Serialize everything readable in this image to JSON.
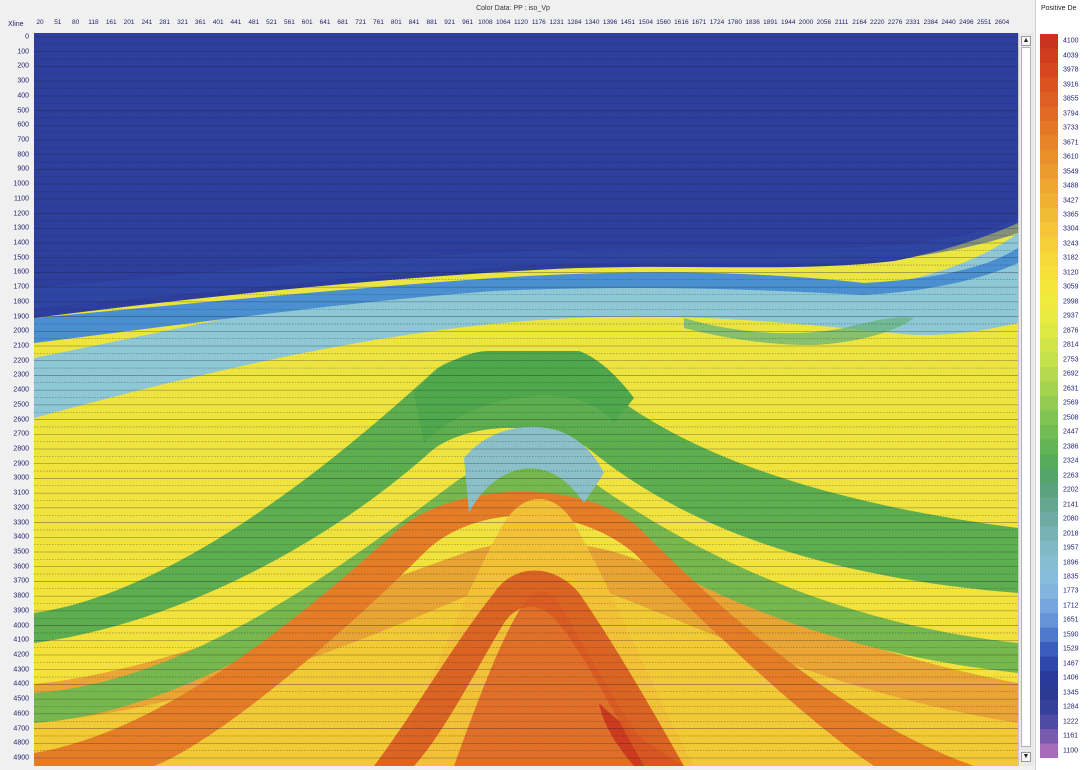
{
  "window": {
    "title": "Color Data: PP : iso_Vp",
    "xline_label": "Xline",
    "legend_title": "Positive De"
  },
  "scrollbar": {
    "up_glyph": "▲",
    "down_glyph": "▼"
  },
  "colors": {
    "background": "#f0f0f0",
    "axis_text": "#1e1e6e",
    "horizon_line": "#2a2a2a"
  },
  "chart_data": {
    "type": "heatmap",
    "title": "Color Data: PP : iso_Vp",
    "xlabel": "Xline",
    "ylabel": "",
    "x_ticks": [
      "20",
      "51",
      "80",
      "118",
      "161",
      "201",
      "241",
      "281",
      "321",
      "361",
      "401",
      "441",
      "481",
      "521",
      "561",
      "601",
      "641",
      "681",
      "721",
      "761",
      "801",
      "841",
      "881",
      "921",
      "961",
      "1008",
      "1064",
      "1120",
      "1176",
      "1231",
      "1284",
      "1340",
      "1396",
      "1451",
      "1504",
      "1560",
      "1616",
      "1671",
      "1724",
      "1780",
      "1836",
      "1891",
      "1944",
      "2000",
      "2056",
      "2111",
      "2164",
      "2220",
      "2276",
      "2331",
      "2384",
      "2440",
      "2496",
      "2551",
      "2604"
    ],
    "y_ticks": [
      0,
      100,
      200,
      300,
      400,
      500,
      600,
      700,
      800,
      900,
      1000,
      1100,
      1200,
      1300,
      1400,
      1500,
      1600,
      1700,
      1800,
      1900,
      2000,
      2100,
      2200,
      2300,
      2400,
      2500,
      2600,
      2700,
      2800,
      2900,
      3000,
      3100,
      3200,
      3300,
      3400,
      3500,
      3600,
      3700,
      3800,
      3900,
      4000,
      4100,
      4200,
      4300,
      4400,
      4500,
      4600,
      4700,
      4800,
      4900
    ],
    "xlim": [
      20,
      2630
    ],
    "ylim": [
      0,
      4900
    ],
    "colorbar": {
      "label": "Positive De",
      "values": [
        4100,
        4039,
        3978,
        3916,
        3855,
        3794,
        3733,
        3671,
        3610,
        3549,
        3488,
        3427,
        3365,
        3304,
        3243,
        3182,
        3120,
        3059,
        2998,
        2937,
        2876,
        2814,
        2753,
        2692,
        2631,
        2569,
        2508,
        2447,
        2386,
        2324,
        2263,
        2202,
        2141,
        2080,
        2018,
        1957,
        1896,
        1835,
        1773,
        1712,
        1651,
        1590,
        1529,
        1467,
        1406,
        1345,
        1284,
        1222,
        1161,
        1100
      ],
      "colors": [
        "#c8321e",
        "#cf3c1e",
        "#d5461f",
        "#da5321",
        "#de5f23",
        "#e16b24",
        "#e47826",
        "#e78428",
        "#ea902b",
        "#ec9b2e",
        "#eea731",
        "#f0b133",
        "#f2bb35",
        "#f3c537",
        "#f5cf37",
        "#f6d838",
        "#f6e039",
        "#f4e63b",
        "#f0ea3e",
        "#e9eb41",
        "#dfe944",
        "#d2e548",
        "#c4e04b",
        "#b5da4d",
        "#a4d34f",
        "#93cc51",
        "#82c452",
        "#71bc53",
        "#62b454",
        "#58ab5b",
        "#55a56a",
        "#5aa37d",
        "#64a690",
        "#6eaba3",
        "#78b2b6",
        "#80b8c6",
        "#86bdd2",
        "#88bcdb",
        "#82b4de",
        "#76a6dd",
        "#6592d8",
        "#4f78cc",
        "#3b5dbd",
        "#2e47ab",
        "#2a3a9c",
        "#2c3a94",
        "#34409a",
        "#4d4ba4",
        "#7a5aaf",
        "#a66bba"
      ]
    },
    "grid": true,
    "legend_position": "right"
  }
}
